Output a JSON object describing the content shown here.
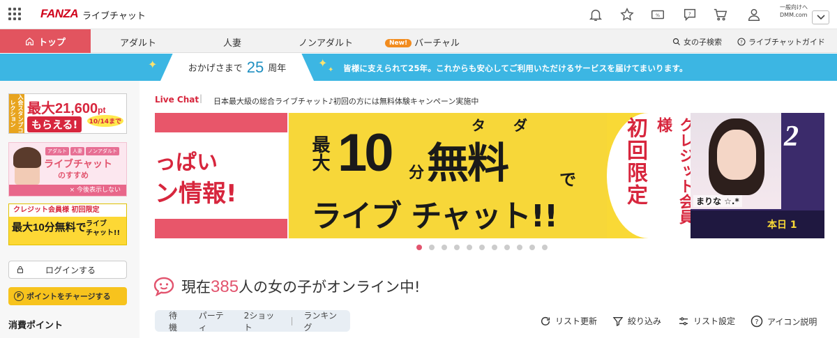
{
  "header": {
    "logo": "FANZA",
    "app_name": "ライブチャット",
    "account_line1": "一般向けへ",
    "account_line2": "DMM.com",
    "icons": [
      "grid-icon",
      "bell-icon",
      "star-icon",
      "coupon-icon",
      "help-icon",
      "cart-icon",
      "user-icon",
      "chevron-down-icon"
    ]
  },
  "nav": {
    "top": "トップ",
    "items": [
      "アダルト",
      "人妻",
      "ノンアダルト"
    ],
    "new_badge": "New!",
    "virtual": "バーチャル",
    "search": "女の子検索",
    "guide": "ライブチャットガイド"
  },
  "anniversary": {
    "prefix": "おかげさまで",
    "number": "25",
    "suffix": "周年",
    "message": "皆様に支えられて25年。これからも安心してご利用いただけるサービスを届けてまいります。"
  },
  "sidebar": {
    "banner1": {
      "tag": "入会スタンプコレクション",
      "amount": "最大21,600",
      "unit": "pt",
      "get": "もらえる!",
      "date": "10/14まで"
    },
    "banner2": {
      "tags": [
        "アダルト",
        "人妻",
        "ノンアダルト"
      ],
      "title": "ライブチャット",
      "sub": "のすすめ",
      "hide": "× 今後表示しない"
    },
    "banner3": {
      "top": "クレジット会員様 初回限定",
      "main": "最大10分無料で",
      "right1": "ライブ",
      "right2": "チャット!!"
    },
    "login": "ログインする",
    "charge": "ポイントをチャージする",
    "points_label": "消費ポイント"
  },
  "main": {
    "livechat_label": "Live Chat",
    "separator": "|",
    "tagline": "日本最大級の総合ライブチャット♪初回の方には無料体験キャンペーン実施中",
    "hero": {
      "left_line1": "っぱい",
      "left_line2": "ン情報!",
      "tada": "タダ",
      "saidai": "最大",
      "ten": "10",
      "fun": "分",
      "muryo": "無料",
      "de": "で",
      "livechat": "ライブ チャット!!",
      "shokai": "初回限定",
      "credit": "クレジット会員様",
      "name": "まりな ☆.*",
      "big_right": "2",
      "honjitsu": "本日 1"
    },
    "carousel_total": 11,
    "carousel_active": 0,
    "online_prefix": "現在",
    "online_count": "385",
    "online_suffix": "人の女の子がオンライン中!",
    "tabs": [
      "待機",
      "パーティ",
      "2ショット",
      "ランキング"
    ],
    "tools": {
      "refresh": "リスト更新",
      "filter": "絞り込み",
      "settings": "リスト設定",
      "icon_help": "アイコン説明"
    }
  },
  "colors": {
    "accent": "#e2546e",
    "brand_red": "#d0021b",
    "anniv_blue": "#3cb6e3",
    "hero_yellow": "#f7d739",
    "charge_yellow": "#f7c31d"
  }
}
